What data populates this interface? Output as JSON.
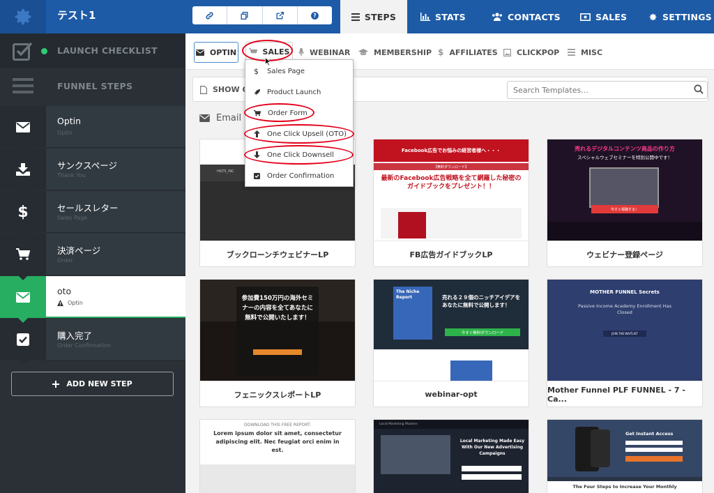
{
  "header": {
    "funnel_title": "テスト1",
    "nav": [
      {
        "label": "STEPS",
        "icon": "list-icon",
        "active": true
      },
      {
        "label": "STATS",
        "icon": "bar-chart-icon"
      },
      {
        "label": "CONTACTS",
        "icon": "users-icon"
      },
      {
        "label": "SALES",
        "icon": "money-icon"
      },
      {
        "label": "SETTINGS",
        "icon": "gear-icon"
      }
    ],
    "tools": [
      "link-icon",
      "copy-icon",
      "external-link-icon",
      "help-icon"
    ]
  },
  "sidebar": {
    "launch_checklist": "LAUNCH CHECKLIST",
    "funnel_steps": "FUNNEL STEPS",
    "steps": [
      {
        "name": "Optin",
        "type": "Optin",
        "icon": "envelope-icon"
      },
      {
        "name": "サンクスページ",
        "type": "Thank You",
        "icon": "download-icon"
      },
      {
        "name": "セールスレター",
        "type": "Sales Page",
        "icon": "dollar-icon"
      },
      {
        "name": "決済ページ",
        "type": "Order",
        "icon": "cart-icon"
      },
      {
        "name": "oto",
        "type": "Optin",
        "icon": "envelope-icon",
        "active": true,
        "warning": true
      },
      {
        "name": "購入完了",
        "type": "Order Confirmation",
        "icon": "checkbox-icon"
      }
    ],
    "add_step": "ADD NEW STEP"
  },
  "subnav": {
    "tabs": [
      {
        "label": "OPTIN",
        "icon": "envelope-icon"
      },
      {
        "label": "SALES",
        "icon": "cart-icon"
      },
      {
        "label": "WEBINAR",
        "icon": "mic-icon"
      },
      {
        "label": "MEMBERSHIP",
        "icon": "graduation-icon"
      },
      {
        "label": "AFFILIATES",
        "icon": "dollar-icon"
      },
      {
        "label": "CLICKPOP",
        "icon": "image-icon"
      },
      {
        "label": "MISC",
        "icon": "list-icon"
      }
    ]
  },
  "dropdown": {
    "items": [
      {
        "label": "Sales Page",
        "icon": "dollar-icon"
      },
      {
        "label": "Product Launch",
        "icon": "rocket-icon"
      },
      {
        "label": "Order Form",
        "icon": "cart-icon"
      },
      {
        "label": "One Click Upsell (OTO)",
        "icon": "arrow-up-icon"
      },
      {
        "label": "One Click Downsell",
        "icon": "arrow-down-icon"
      },
      {
        "label": "Order Confirmation",
        "icon": "checkbox-icon"
      }
    ]
  },
  "filter": {
    "show_only": "SHOW ON",
    "search_placeholder": "Search Templates..."
  },
  "section": {
    "title": "Email O"
  },
  "templates": [
    {
      "label": "ブックローンチウェビナーLP",
      "thumb_text": "HILTS_INC"
    },
    {
      "label": "FB広告ガイドブックLP",
      "thumb_top": "Facebook広告でお悩みの経営者様へ・・・",
      "thumb_badge": "【無料ダウンロード】",
      "thumb_headline": "最新のFacebook広告戦略を全て網羅した秘密のガイドブックをプレゼント！！"
    },
    {
      "label": "ウェビナー登録ページ",
      "thumb_title": "売れるデジタルコンテンツ商品の作り方",
      "thumb_sub": "スペシャルウェブセミナーを特別公開中です！",
      "thumb_btn": "今すぐ視聴する！"
    },
    {
      "label": "フェニックスレポートLP",
      "thumb_text": "参加費150万円の海外セミナーの内容を全てあなたに無料で公開いたします！"
    },
    {
      "label": "webinar-opt",
      "thumb_book": "The Niche Report",
      "thumb_text": "売れる２９個のニッチアイデアをあなたに無料で公開します！",
      "thumb_btn": "今すぐ無料ダウンロード"
    },
    {
      "label": "Mother Funnel PLF FUNNEL - 7 - Ca...",
      "thumb_logo": "MOTHER FUNNEL Secrets",
      "thumb_text": "Passive Income Academy Enrollment Has Closed",
      "thumb_btn": "JOIN THE WAITLIST"
    },
    {
      "label": "",
      "thumb_top": "DOWNLOAD THIS FREE REPORT:",
      "thumb_text": "Lorem ipsum dolor sit amet, consectetur adipiscing elit. Nec feugiat orci enim in est."
    },
    {
      "label": "",
      "thumb_top": "Local Marketing Masters",
      "thumb_text": "Local Marketing Made Easy With Our New Advertising Campaigns"
    },
    {
      "label": "",
      "thumb_text": "Get Instant Access",
      "thumb_bottom": "The Four Steps to Increase Your Monthly"
    }
  ],
  "colors": {
    "topbar": "#1d5ba7",
    "sidebar": "#2a3036",
    "active_green": "#27ae60",
    "annotation_red": "#e3001b"
  }
}
